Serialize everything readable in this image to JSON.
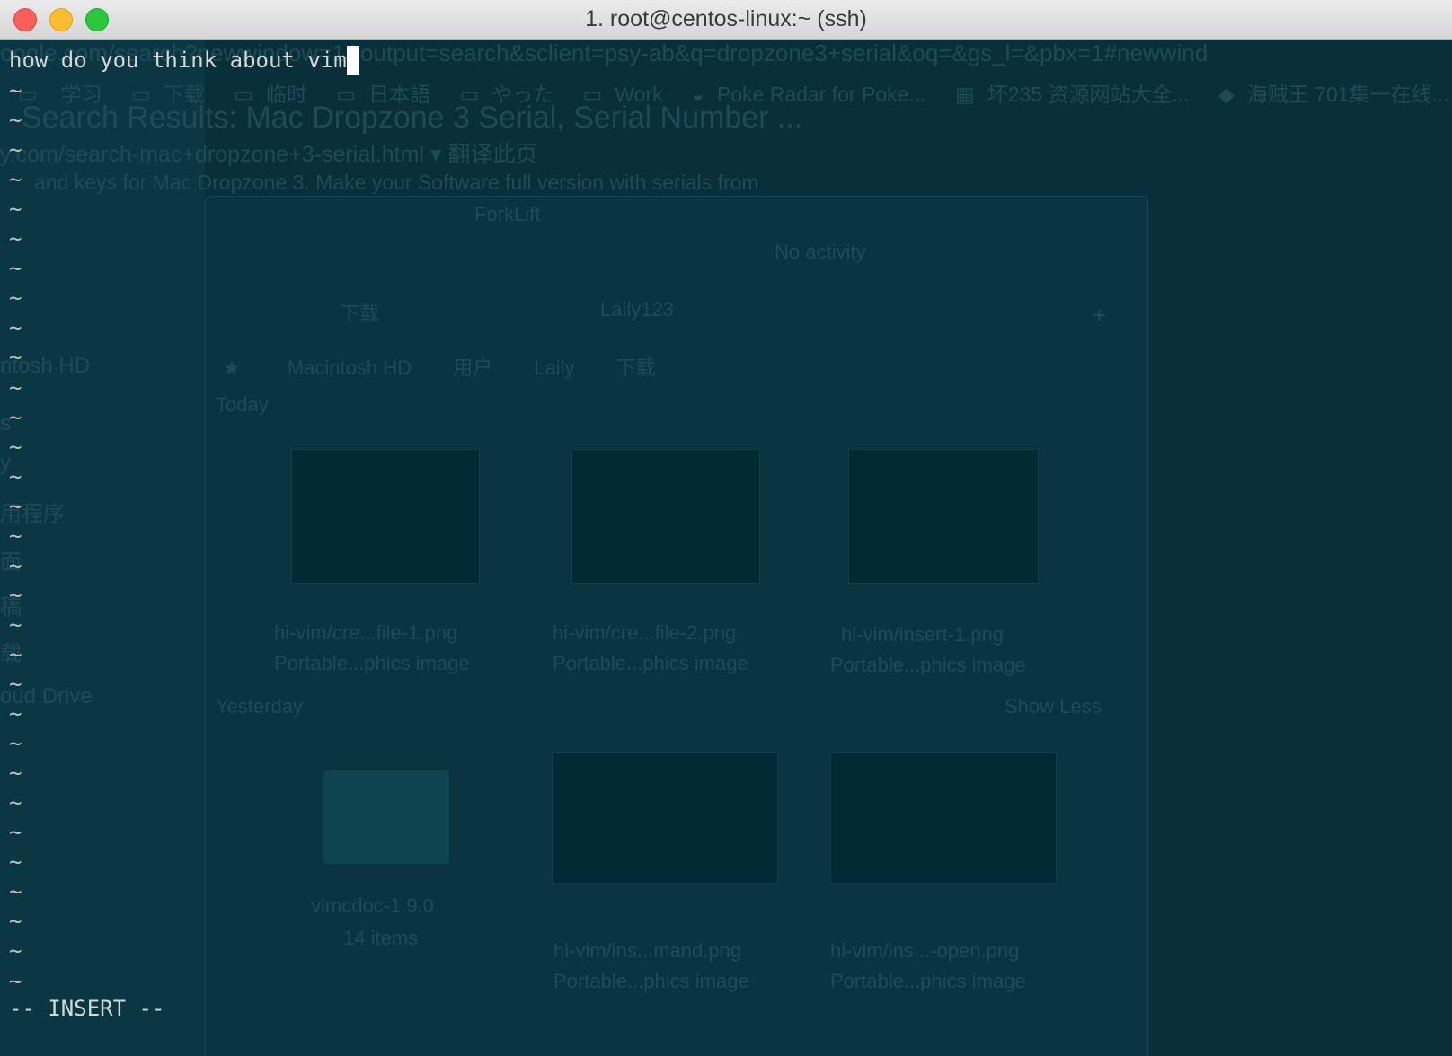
{
  "window": {
    "title": "1. root@centos-linux:~ (ssh)"
  },
  "background": {
    "url_bar": "oogle.com/search?newwindow=1&output=search&sclient=psy-ab&q=dropzone3+serial&oq=&gs_l=&pbx=1#newwind",
    "bookmarks": [
      "学习",
      "下载",
      "临时",
      "日本語",
      "やった",
      "Work",
      "Poke Radar for Poke...",
      "坏235 资源网站大全...",
      "海贼王 701集一在线..."
    ],
    "result_title": "Search Results: Mac Dropzone 3 Serial, Serial Number ...",
    "result_url": "y.com/search-mac+dropzone+3-serial.html ▾ 翻译此页",
    "result_snippet": "and keys for Mac Dropzone 3. Make your Software full version with serials from",
    "forklift": {
      "app_name": "ForkLift",
      "activity": "No activity",
      "tabs": [
        "下载",
        "Laily123"
      ],
      "path": [
        "Macintosh HD",
        "用户",
        "Laily",
        "下载"
      ],
      "section_today": "Today",
      "section_yesterday": "Yesterday",
      "show_less": "Show Less",
      "files_today": [
        {
          "name": "hi-vim/cre...file-1.png",
          "kind": "Portable...phics image"
        },
        {
          "name": "hi-vim/cre...file-2.png",
          "kind": "Portable...phics image"
        },
        {
          "name": "hi-vim/insert-1.png",
          "kind": "Portable...phics image"
        }
      ],
      "files_yesterday": [
        {
          "name": "vimcdoc-1.9.0",
          "kind": "14 items"
        },
        {
          "name": "hi-vim/ins...mand.png",
          "kind": "Portable...phics image"
        },
        {
          "name": "hi-vim/ins...-open.png",
          "kind": "Portable...phics image"
        }
      ],
      "sidebar": [
        "ntosh HD",
        "s",
        "y",
        "用程序",
        "面",
        "稿",
        "载",
        "oud Drive"
      ]
    }
  },
  "terminal": {
    "first_line": "how do you think about vim",
    "tilde": "~",
    "mode": "-- INSERT --"
  }
}
